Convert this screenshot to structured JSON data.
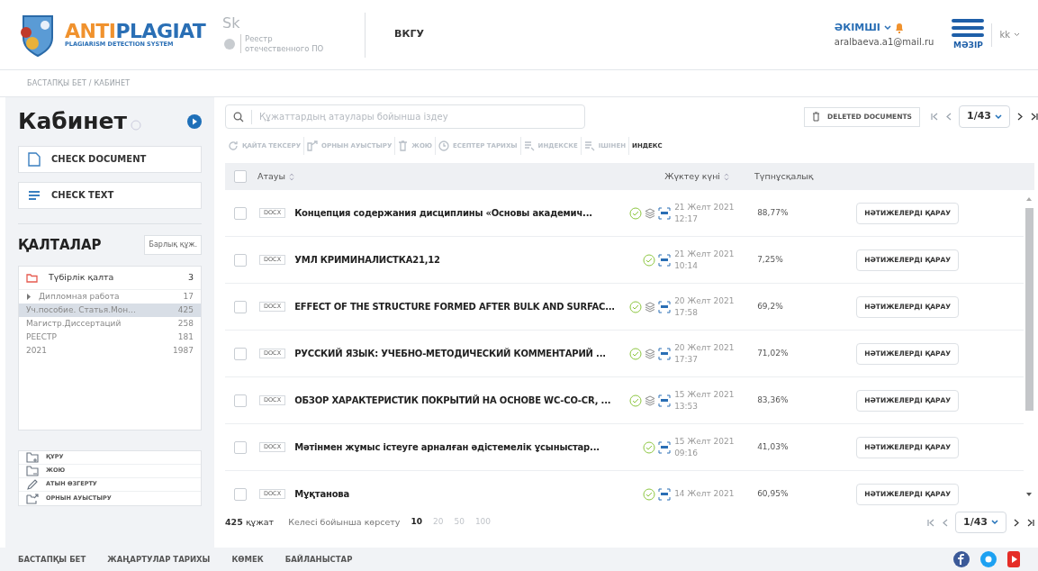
{
  "header": {
    "logo_title_a": "ANTI",
    "logo_title_b": "PLAGIAT",
    "logo_subtitle": "PLAGIARISM DETECTION SYSTEM",
    "partner_mark": "Sk",
    "registry_label": "Реестр\nотечественного ПО",
    "organization": "ВКГУ",
    "user_role": "ӘКІМШІ",
    "user_email": "aralbaeva.a1@mail.ru",
    "menu_label": "МӘЗІР",
    "language": "kk"
  },
  "breadcrumb": "БАСТАПҚЫ БЕТ / КАБИНЕТ",
  "sidebar": {
    "title": "Кабинет",
    "actions": [
      {
        "label": "CHECK DOCUMENT",
        "kind": "document"
      },
      {
        "label": "CHECK TEXT",
        "kind": "text"
      }
    ],
    "folders_title": "ҚАЛТАЛАР",
    "folders_filter": "Барлық құж.",
    "folders": [
      {
        "name": "Түбірлік қалта",
        "count": "3",
        "selected": false,
        "children": [
          {
            "name": "Дипломная работа",
            "count": "17",
            "selected": false,
            "expanded": false
          },
          {
            "name": "Уч.пособие. Статья.Мон...",
            "count": "425",
            "selected": true
          },
          {
            "name": "Магистр.Диссертаций",
            "count": "258",
            "selected": false
          },
          {
            "name": "РЕЕСТР",
            "count": "181",
            "selected": false
          },
          {
            "name": "2021",
            "count": "1987",
            "selected": false
          }
        ]
      }
    ],
    "folder_actions": [
      {
        "label": "ҚҰРУ",
        "kind": "create"
      },
      {
        "label": "ЖОЮ",
        "kind": "delete"
      },
      {
        "label": "АТЫН ӨЗГЕРТУ",
        "kind": "rename"
      },
      {
        "label": "ОРНЫН АУЫСТЫРУ",
        "kind": "move"
      }
    ]
  },
  "search": {
    "placeholder": "Құжаттардың атаулары бойынша іздеу"
  },
  "deleted_button": "DELETED DOCUMENTS",
  "pagination_top": {
    "page": "1/43"
  },
  "toolbar": [
    {
      "label": "ҚАЙТА ТЕКСЕРУ",
      "kind": "recheck",
      "disabled": true
    },
    {
      "label": "ОРНЫН АУЫСТЫРУ",
      "kind": "move",
      "disabled": true
    },
    {
      "label": "ЖОЮ",
      "kind": "delete",
      "disabled": true
    },
    {
      "label": "ЕСЕПТЕР ТАРИХЫ",
      "kind": "history",
      "disabled": true
    },
    {
      "label": "ИНДЕКСКЕ",
      "kind": "index",
      "disabled": true
    },
    {
      "label": "ІШІНЕН",
      "kind": "index",
      "disabled": true
    },
    {
      "label": "ИНДЕКС",
      "kind": "plain",
      "disabled": false
    }
  ],
  "table": {
    "select_all_checked": false,
    "columns": [
      "Атауы",
      "Жүктеу күні",
      "Түпнұсқалық"
    ],
    "rows": [
      {
        "type": "DOCX",
        "title": "Концепция содержания дисциплины «Основы академич...",
        "checked": false,
        "layers": true,
        "date": "21 Желт 2021",
        "time": "12:17",
        "originality": "88,77%",
        "action": "НӘТИЖЕЛЕРДІ ҚАРАУ"
      },
      {
        "type": "DOCX",
        "title": "УМЛ КРИМИНАЛИСТКА21,12",
        "checked": false,
        "layers": false,
        "date": "21 Желт 2021",
        "time": "10:14",
        "originality": "7,25%",
        "action": "НӘТИЖЕЛЕРДІ ҚАРАУ"
      },
      {
        "type": "DOCX",
        "title": "EFFECT OF THE STRUCTURE FORMED AFTER BULK AND SURFAC...",
        "checked": false,
        "layers": true,
        "date": "20 Желт 2021",
        "time": "17:58",
        "originality": "69,2%",
        "action": "НӘТИЖЕЛЕРДІ ҚАРАУ"
      },
      {
        "type": "DOCX",
        "title": "РУССКИЙ ЯЗЫК: УЧЕБНО-МЕТОДИЧЕСКИЙ КОММЕНТАРИЙ ...",
        "checked": false,
        "layers": true,
        "date": "20 Желт 2021",
        "time": "17:37",
        "originality": "71,02%",
        "action": "НӘТИЖЕЛЕРДІ ҚАРАУ"
      },
      {
        "type": "DOCX",
        "title": "ОБЗОР ХАРАКТЕРИСТИК ПОКРЫТИЙ НА ОСНОВЕ WC-CO-CR, ...",
        "checked": false,
        "layers": true,
        "date": "15 Желт 2021",
        "time": "13:53",
        "originality": "83,36%",
        "action": "НӘТИЖЕЛЕРДІ ҚАРАУ"
      },
      {
        "type": "DOCX",
        "title": "Мәтінмен жұмыс істеуге арналған әдістемелік ұсыныстар...",
        "checked": false,
        "layers": false,
        "date": "15 Желт 2021",
        "time": "09:16",
        "originality": "41,03%",
        "action": "НӘТИЖЕЛЕРДІ ҚАРАУ"
      },
      {
        "type": "DOCX",
        "title": "Мұқтанова",
        "checked": false,
        "layers": false,
        "date": "14 Желт 2021",
        "originality": "60,95%",
        "action": "НӘТИЖЕЛЕРДІ ҚАРАУ"
      }
    ]
  },
  "footer_bar": {
    "total_count": "425",
    "total_unit": "құжат",
    "page_size_label": "Келесі бойынша көрсету",
    "page_sizes": [
      {
        "label": "10",
        "selected": true
      },
      {
        "label": "20",
        "selected": false
      },
      {
        "label": "50",
        "selected": false
      },
      {
        "label": "100",
        "selected": false
      }
    ],
    "page": "1/43"
  },
  "footer_links": [
    "БАСТАПҚЫ БЕТ",
    "ЖАҢАРТУЛАР ТАРИХЫ",
    "КӨМЕК",
    "БАЙЛАНЫСТАР"
  ]
}
